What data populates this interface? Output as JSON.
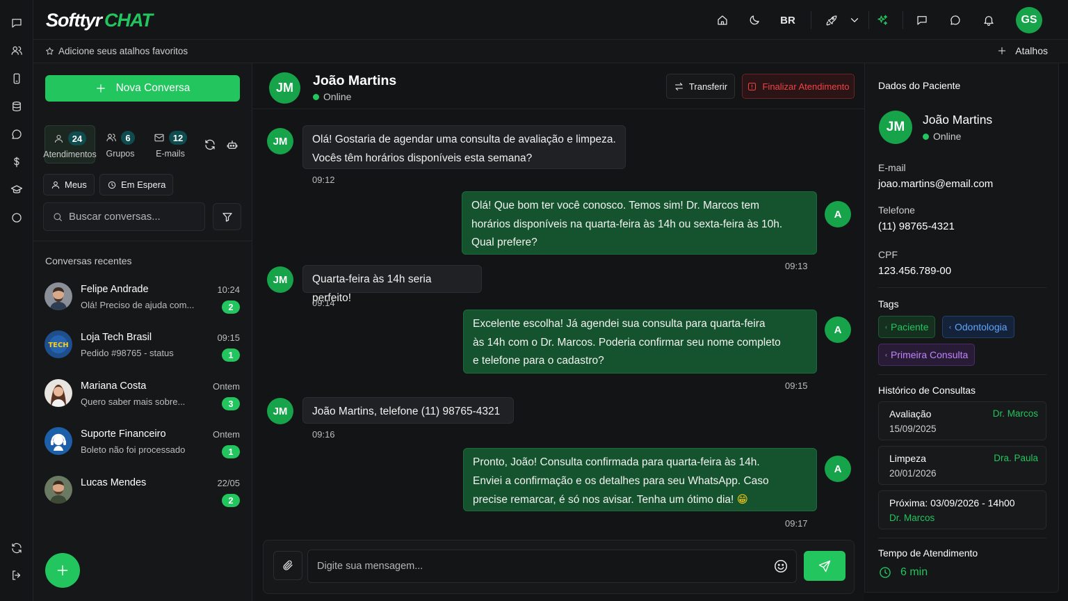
{
  "brand": {
    "part1": "Softtyr",
    "part2": "CHAT"
  },
  "topbar": {
    "lang": "BR",
    "user_initials": "GS"
  },
  "favorites": {
    "hint": "Adicione seus atalhos favoritos",
    "shortcuts_label": "Atalhos"
  },
  "left": {
    "new_conversation": "Nova Conversa",
    "tabs": [
      {
        "label": "Atendimentos",
        "count": "24"
      },
      {
        "label": "Grupos",
        "count": "6"
      },
      {
        "label": "E-mails",
        "count": "12"
      }
    ],
    "filters": {
      "mine": "Meus",
      "waiting": "Em Espera"
    },
    "search_placeholder": "Buscar conversas...",
    "recent_title": "Conversas recentes",
    "conversations": [
      {
        "name": "Felipe Andrade",
        "preview": "Olá! Preciso de ajuda com...",
        "time": "10:24",
        "unread": "2"
      },
      {
        "name": "Loja Tech Brasil",
        "preview": "Pedido #98765 - status",
        "time": "09:15",
        "unread": "1"
      },
      {
        "name": "Mariana Costa",
        "preview": "Quero saber mais sobre...",
        "time": "Ontem",
        "unread": "3"
      },
      {
        "name": "Suporte Financeiro",
        "preview": "Boleto não foi processado",
        "time": "Ontem",
        "unread": "1"
      },
      {
        "name": "Lucas Mendes",
        "preview": "",
        "time": "22/05",
        "unread": "2"
      }
    ]
  },
  "chat": {
    "contact_initials": "JM",
    "contact_name": "João Martins",
    "contact_status": "Online",
    "agent_initial": "A",
    "transfer": "Transferir",
    "finalize": "Finalizar Atendimento",
    "messages": [
      {
        "dir": "in",
        "line1": "Olá! Gostaria de agendar uma consulta de avaliação e limpeza.",
        "line2": "Vocês têm horários disponíveis esta semana?",
        "line3": "",
        "time": "09:12"
      },
      {
        "dir": "out",
        "line1": "Olá! Que bom ter você conosco. Temos sim! Dr. Marcos tem",
        "line2": "horários disponíveis na quarta-feira às 14h ou sexta-feira às 10h.",
        "line3": "Qual prefere?",
        "time": "09:13"
      },
      {
        "dir": "in",
        "line1": "Quarta-feira às 14h seria perfeito!",
        "line2": "",
        "line3": "",
        "time": "09:14"
      },
      {
        "dir": "out",
        "line1": "Excelente escolha! Já agendei sua consulta para quarta-feira",
        "line2": "às 14h com o Dr. Marcos. Poderia confirmar seu nome completo",
        "line3": "e telefone para o cadastro?",
        "time": "09:15"
      },
      {
        "dir": "in",
        "line1": "João Martins, telefone (11) 98765-4321",
        "line2": "",
        "line3": "",
        "time": "09:16"
      },
      {
        "dir": "out",
        "line1": "Pronto, João! Consulta confirmada para quarta-feira às 14h.",
        "line2": "Enviei a confirmação e os detalhes para seu WhatsApp. Caso",
        "line3": "precise remarcar, é só nos avisar. Tenha um ótimo dia!",
        "emoji": "😁",
        "time": "09:17"
      }
    ],
    "input_placeholder": "Digite sua mensagem..."
  },
  "patient": {
    "panel_title": "Dados do Paciente",
    "initials": "JM",
    "name": "João Martins",
    "status": "Online",
    "email_label": "E-mail",
    "email": "joao.martins@email.com",
    "phone_label": "Telefone",
    "phone": "(11) 98765-4321",
    "cpf_label": "CPF",
    "cpf": "123.456.789-00",
    "tags_label": "Tags",
    "tags": [
      {
        "label": "Paciente",
        "color": "#22c55e"
      },
      {
        "label": "Odontologia",
        "color": "#60a5fa"
      },
      {
        "label": "Primeira Consulta",
        "color": "#c084fc"
      }
    ],
    "history_label": "Histórico de Consultas",
    "history": [
      {
        "title": "Avaliação",
        "date": "15/09/2025",
        "doctor": "Dr. Marcos"
      },
      {
        "title": "Limpeza",
        "date": "20/01/2026",
        "doctor": "Dra. Paula"
      },
      {
        "title": "Próxima: 03/09/2026 - 14h00",
        "date": "Dr. Marcos",
        "doctor": ""
      }
    ],
    "service_time_label": "Tempo de Atendimento",
    "service_time": "6 min"
  },
  "colors": {
    "accent": "#22c55e",
    "danger": "#ef4444",
    "bg": "#111214"
  }
}
